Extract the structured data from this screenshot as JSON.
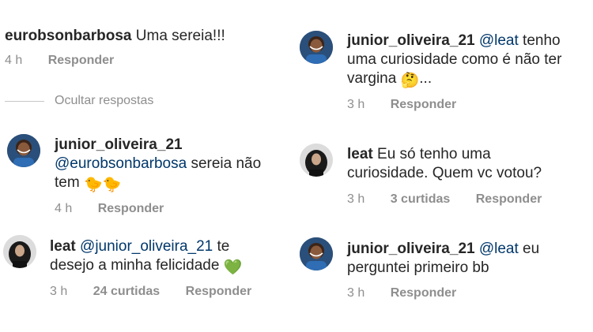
{
  "left_column": {
    "comment_1": {
      "username": "eurobsonbarbosa",
      "text": "Uma sereia!!!",
      "time": "4 h",
      "reply_label": "Responder"
    },
    "hide_replies_label": "Ocultar respostas",
    "reply_1": {
      "username": "junior_oliveira_21",
      "mention": "@eurobsonbarbosa",
      "text_line1": " sereia  não",
      "text_line2": "tem ",
      "emoji": "🐤🐤",
      "time": "4 h",
      "reply_label": "Responder"
    },
    "reply_2": {
      "username": "leat",
      "mention": "@junior_oliveira_21",
      "text_line1": " te",
      "text_line2": "desejo a minha felicidade ",
      "emoji": "💚",
      "time": "3 h",
      "likes": "24 curtidas",
      "reply_label": "Responder"
    }
  },
  "right_column": {
    "reply_3": {
      "username": "junior_oliveira_21",
      "mention": "@leat",
      "text_line1": " tenho",
      "text_line2": "uma curiosidade  como é não ter",
      "text_line3": "vargina ",
      "emoji": "🤔",
      "text_end": "...",
      "time": "3 h",
      "reply_label": "Responder"
    },
    "reply_4": {
      "username": "leat",
      "text_line1": " Eu só tenho uma",
      "text_line2": "curiosidade. Quem vc votou?",
      "time": "3 h",
      "likes": "3 curtidas",
      "reply_label": "Responder"
    },
    "reply_5": {
      "username": "junior_oliveira_21",
      "mention": "@leat",
      "text_line1": "  eu",
      "text_line2": "perguntei  primeiro  bb",
      "time": "3 h",
      "reply_label": "Responder"
    }
  }
}
